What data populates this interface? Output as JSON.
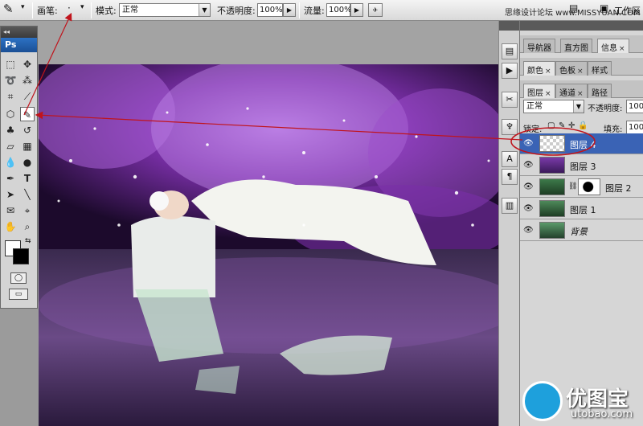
{
  "options_bar": {
    "brush_label": "画笔:",
    "mode_label": "模式:",
    "mode_value": "正常",
    "opacity_label": "不透明度:",
    "opacity_value": "100%",
    "flow_label": "流量:",
    "flow_value": "100%",
    "workspace_label": "工作区",
    "site_text": "思缘设计论坛 www.MISSYUAN.COM"
  },
  "toolbox": {
    "logo": "Ps"
  },
  "panels": {
    "group1_tabs": [
      {
        "label": "导航器",
        "active": false
      },
      {
        "label": "直方图",
        "active": false
      },
      {
        "label": "信息",
        "active": true
      }
    ],
    "group2_tabs": [
      {
        "label": "颜色",
        "active": true
      },
      {
        "label": "色板",
        "active": false
      },
      {
        "label": "样式",
        "active": false
      }
    ],
    "group3_tabs": [
      {
        "label": "图层",
        "active": true
      },
      {
        "label": "通道",
        "active": false
      },
      {
        "label": "路径",
        "active": false
      }
    ],
    "blend_mode": "正常",
    "opacity_label": "不透明度:",
    "opacity_value": "100%",
    "lock_label": "锁定:",
    "fill_label": "填充:",
    "fill_value": "100%",
    "layers": [
      {
        "name": "图层 4",
        "selected": true,
        "has_mask": false
      },
      {
        "name": "图层 3",
        "selected": false,
        "has_mask": false
      },
      {
        "name": "图层 2",
        "selected": false,
        "has_mask": true
      },
      {
        "name": "图层 1",
        "selected": false,
        "has_mask": false
      },
      {
        "name": "背景",
        "selected": false,
        "has_mask": false
      }
    ]
  },
  "watermark": {
    "title": "优图宝",
    "url": "utobao.com"
  },
  "colors": {
    "accent": "#3a63b5",
    "annotation": "#c0141c"
  }
}
